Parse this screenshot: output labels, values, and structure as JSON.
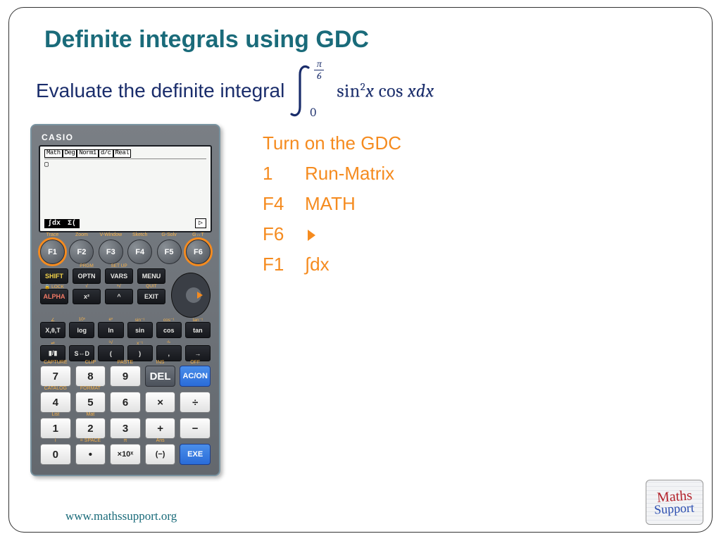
{
  "title": "Definite integrals using GDC",
  "problem_text": "Evaluate the definite integral",
  "integral": {
    "upper_num": "π",
    "upper_den": "6",
    "lower": "0",
    "integrand_html": "sin²x cos x dx"
  },
  "calculator": {
    "brand": "CASIO",
    "screen_status": [
      "Math",
      "Deg",
      "Norm1",
      "d/c",
      "Real"
    ],
    "soft_labels": [
      "∫dx",
      "Σ("
    ],
    "fkeys": [
      {
        "label": "F1",
        "top": "Trace",
        "highlight": true
      },
      {
        "label": "F2",
        "top": "Zoom",
        "highlight": false
      },
      {
        "label": "F3",
        "top": "V-Window",
        "highlight": false
      },
      {
        "label": "F4",
        "top": "Sketch",
        "highlight": false
      },
      {
        "label": "F5",
        "top": "G-Solv",
        "highlight": false
      },
      {
        "label": "F6",
        "top": "G↔T",
        "highlight": true
      }
    ],
    "mid_rows": [
      [
        {
          "t": "SHIFT",
          "cls": "yellow"
        },
        {
          "t": "OPTN",
          "up": "PRGM"
        },
        {
          "t": "VARS",
          "up": "SET UP"
        },
        {
          "t": "MENU"
        }
      ],
      [
        {
          "t": "ALPHA",
          "cls": "redtxt",
          "up": "🔒 LOCK"
        },
        {
          "t": "x²",
          "up": "√"
        },
        {
          "t": "^",
          "up": "ˣ√"
        },
        {
          "t": "EXIT",
          "up": "QUIT"
        }
      ]
    ],
    "sci_rows": [
      [
        {
          "t": "X,θ,T",
          "up": "∠"
        },
        {
          "t": "log",
          "up": "10ˣ"
        },
        {
          "t": "ln",
          "up": "eˣ"
        },
        {
          "t": "sin",
          "up": "sin⁻¹"
        },
        {
          "t": "cos",
          "up": "cos⁻¹"
        },
        {
          "t": "tan",
          "up": "tan⁻¹"
        }
      ],
      [
        {
          "t": "▮/▮",
          "up": "⇌"
        },
        {
          "t": "S⇔D",
          "up": ""
        },
        {
          "t": "(",
          "up": "³√"
        },
        {
          "t": ")",
          "up": "x⁻¹"
        },
        {
          "t": ",",
          "up": "ᵈ▫"
        },
        {
          "t": "→",
          "up": ""
        }
      ]
    ],
    "numpad": [
      [
        {
          "t": "7",
          "up": "CAPTURE"
        },
        {
          "t": "8",
          "up": "CLIP"
        },
        {
          "t": "9",
          "up": "PASTE"
        },
        {
          "t": "DEL",
          "cls": "delbtn",
          "up": "INS"
        },
        {
          "t": "AC/ON",
          "cls": "bluebtn small",
          "up": "OFF"
        }
      ],
      [
        {
          "t": "4",
          "up": "CATALOG"
        },
        {
          "t": "5",
          "up": "FORMAT"
        },
        {
          "t": "6",
          "up": ""
        },
        {
          "t": "×",
          "up": ""
        },
        {
          "t": "÷",
          "up": ""
        }
      ],
      [
        {
          "t": "1",
          "up": "List"
        },
        {
          "t": "2",
          "up": "Mat"
        },
        {
          "t": "3",
          "up": ""
        },
        {
          "t": "+",
          "up": ""
        },
        {
          "t": "−",
          "up": ""
        }
      ],
      [
        {
          "t": "0",
          "up": "i"
        },
        {
          "t": "•",
          "up": "= SPACE"
        },
        {
          "t": "×10ˣ",
          "cls": "small",
          "up": "π"
        },
        {
          "t": "(−)",
          "cls": "small",
          "up": "Ans"
        },
        {
          "t": "EXE",
          "cls": "bluebtn small",
          "up": ""
        }
      ]
    ]
  },
  "instructions": {
    "heading": "Turn on the GDC",
    "steps": [
      {
        "key": "1",
        "action": "Run-Matrix"
      },
      {
        "key": "F4",
        "action": "MATH"
      },
      {
        "key": "F6",
        "action": "▶"
      },
      {
        "key": "F1",
        "action": "∫dx"
      }
    ]
  },
  "footer_url": "www.mathssupport.org",
  "logo": {
    "line1": "Maths",
    "line2": "Support"
  }
}
